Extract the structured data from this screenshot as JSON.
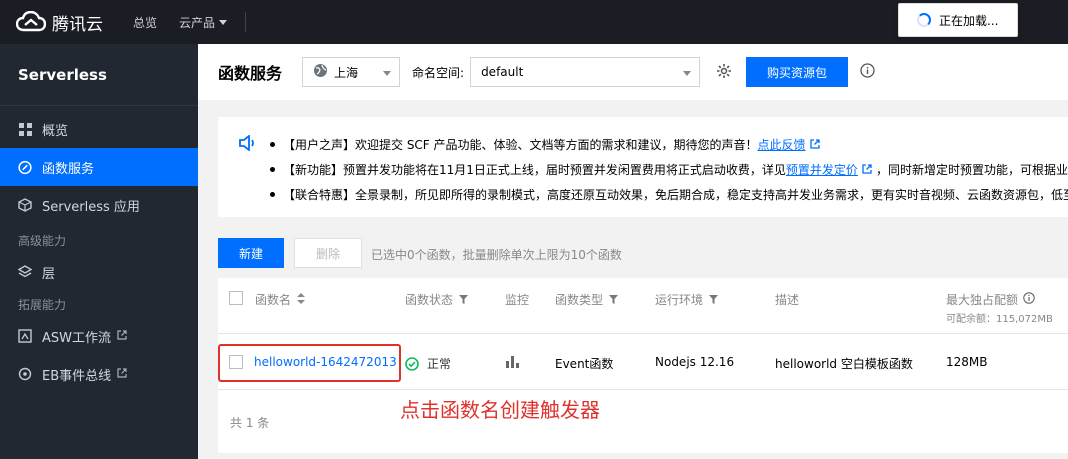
{
  "topbar": {
    "logo": "腾讯云",
    "nav_overview": "总览",
    "nav_products": "云产品",
    "loading": "正在加载..."
  },
  "sidebar": {
    "title": "Serverless",
    "items": [
      {
        "label": "概览",
        "icon": "grid-icon"
      },
      {
        "label": "函数服务",
        "icon": "function-icon",
        "active": true
      },
      {
        "label": "Serverless 应用",
        "icon": "cube-icon"
      }
    ],
    "group_advanced": "高级能力",
    "advanced_items": [
      {
        "label": "层",
        "icon": "layers-icon"
      }
    ],
    "group_extension": "拓展能力",
    "extension_items": [
      {
        "label": "ASW工作流",
        "icon": "workflow-icon"
      },
      {
        "label": "EB事件总线",
        "icon": "eventbus-icon"
      }
    ]
  },
  "header": {
    "title": "函数服务",
    "region": "上海",
    "namespace_label": "命名空间:",
    "namespace": "default",
    "buy_button": "购买资源包"
  },
  "notice": {
    "line1_text": "【用户之声】欢迎提交 SCF 产品功能、体验、文档等方面的需求和建议，期待您的声音！",
    "line1_link": "点此反馈",
    "line2_text": "【新功能】预置并发功能将在11月1日正式上线，届时预置并发闲置费用将正式启动收费，详见",
    "line2_link": "预置并发定价",
    "line2_tail": "，同时新增定时预置功能，可根据业务",
    "line3_text": "【联合特惠】全景录制，所见即所得的录制模式，高度还原互动效果，免后期合成，稳定支持高并发业务需求，更有实时音视频、云函数资源包，低至"
  },
  "toolbar": {
    "new_button": "新建",
    "delete_button": "删除",
    "selection_info": "已选中0个函数，批量删除单次上限为10个函数"
  },
  "table": {
    "headers": {
      "name": "函数名",
      "status": "函数状态",
      "monitor": "监控",
      "type": "函数类型",
      "runtime": "运行环境",
      "desc": "描述",
      "memory": "最大独占配额"
    },
    "quota_note": "可配余额：115,072MB",
    "rows": [
      {
        "name": "helloworld-1642472013",
        "status": "正常",
        "type": "Event函数",
        "runtime": "Nodejs 12.16",
        "desc": "helloworld 空白模板函数",
        "memory": "128MB"
      }
    ],
    "total": "共 1 条"
  },
  "annotation": "点击函数名创建触发器",
  "colors": {
    "accent": "#006eff",
    "annotation": "#e0322d",
    "status_ok": "#0abf5b"
  }
}
